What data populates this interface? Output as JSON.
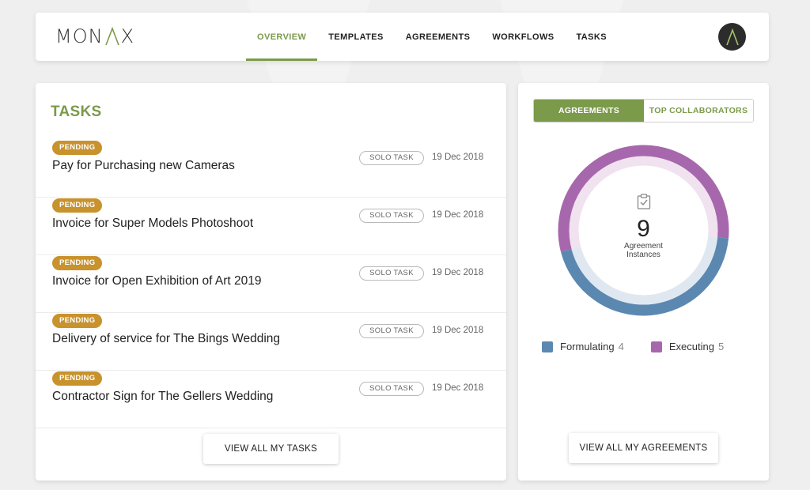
{
  "brand": {
    "logo": "MONAX",
    "logo_parts": [
      "MON",
      "X"
    ]
  },
  "nav": {
    "items": [
      {
        "label": "OVERVIEW",
        "active": true
      },
      {
        "label": "TEMPLATES",
        "active": false
      },
      {
        "label": "AGREEMENTS",
        "active": false
      },
      {
        "label": "WORKFLOWS",
        "active": false
      },
      {
        "label": "TASKS",
        "active": false
      }
    ]
  },
  "tasks": {
    "title": "TASKS",
    "items": [
      {
        "status": "PENDING",
        "name": "Pay for Purchasing new Cameras",
        "type": "SOLO TASK",
        "date": "19 Dec 2018"
      },
      {
        "status": "PENDING",
        "name": "Invoice for Super Models Photoshoot",
        "type": "SOLO TASK",
        "date": "19 Dec 2018"
      },
      {
        "status": "PENDING",
        "name": "Invoice for Open Exhibition of Art 2019",
        "type": "SOLO TASK",
        "date": "19 Dec 2018"
      },
      {
        "status": "PENDING",
        "name": "Delivery of service for The Bings Wedding",
        "type": "SOLO TASK",
        "date": "19 Dec 2018"
      },
      {
        "status": "PENDING",
        "name": "Contractor Sign for The Gellers Wedding",
        "type": "SOLO TASK",
        "date": "19 Dec 2018"
      }
    ],
    "view_all_label": "VIEW ALL MY TASKS"
  },
  "agreements_panel": {
    "tabs": [
      {
        "label": "AGREEMENTS",
        "active": true
      },
      {
        "label": "TOP COLLABORATORS",
        "active": false
      }
    ],
    "total": "9",
    "total_label_line1": "Agreement",
    "total_label_line2": "Instances",
    "center_icon": "clipboard-check-icon",
    "segments": [
      {
        "name": "Formulating",
        "value": 4,
        "color": "#5b88b0"
      },
      {
        "name": "Executing",
        "value": 5,
        "color": "#a767ac"
      }
    ],
    "view_all_label": "VIEW ALL MY AGREEMENTS"
  },
  "colors": {
    "accent": "#7b9a4a",
    "pending": "#c8922c",
    "formulating": "#5b88b0",
    "executing": "#a767ac"
  }
}
